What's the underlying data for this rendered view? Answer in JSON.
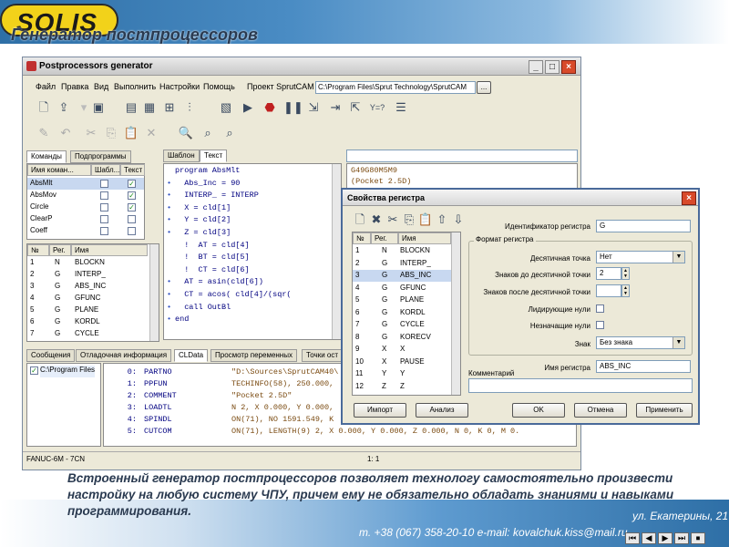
{
  "slide": {
    "logo": "SOLIS",
    "title": "Генератор постпроцессоров",
    "caption": "Встроенный генератор постпроцессоров позволяет технологу самостоятельно произвести настройку на любую систему ЧПУ, причем ему не обязательно обладать знаниями и навыками программирования.",
    "footer_address": "ул. Екатерины, 21",
    "footer_contact": "т. +38 (067) 358-20-10  e-mail: kovalchuk.kiss@mail.ru"
  },
  "window": {
    "title": "Postprocessors generator",
    "menu": [
      "Файл",
      "Правка",
      "Вид",
      "Выполнить",
      "Настройки",
      "Помощь"
    ],
    "project_label": "Проект SprutCAM",
    "project_path": "C:\\Program Files\\Sprut Technology\\SprutCAM",
    "browse_label": "..."
  },
  "left_tabs": [
    "Команды",
    "Подпрограммы"
  ],
  "commands": {
    "headers": [
      "Имя коман...",
      "Шабл...",
      "Текст"
    ],
    "rows": [
      {
        "name": "AbsMlt",
        "template": false,
        "text": true
      },
      {
        "name": "AbsMov",
        "template": false,
        "text": true
      },
      {
        "name": "Circle",
        "template": false,
        "text": true
      },
      {
        "name": "ClearP",
        "template": false,
        "text": false
      },
      {
        "name": "Coeff",
        "template": false,
        "text": false
      }
    ]
  },
  "registers": {
    "headers": [
      "№",
      "Рег.",
      "Имя"
    ],
    "rows": [
      [
        "1",
        "N",
        "BLOCKN"
      ],
      [
        "2",
        "G",
        "INTERP_"
      ],
      [
        "3",
        "G",
        "ABS_INC"
      ],
      [
        "4",
        "G",
        "GFUNC"
      ],
      [
        "5",
        "G",
        "PLANE"
      ],
      [
        "6",
        "G",
        "KORDL"
      ],
      [
        "7",
        "G",
        "CYCLE"
      ]
    ]
  },
  "editor_tabs": [
    "Шаблон",
    "Текст"
  ],
  "code_lines": [
    {
      "b": "",
      "t": "program AbsMlt"
    },
    {
      "b": "•",
      "t": "  Abs_Inc = 90"
    },
    {
      "b": "•",
      "t": "  INTERP_ = INTERP"
    },
    {
      "b": "•",
      "t": "  X = cld[1]"
    },
    {
      "b": "•",
      "t": "  Y = cld[2]"
    },
    {
      "b": "•",
      "t": "  Z = cld[3]"
    },
    {
      "b": "",
      "t": "  !  AT = cld[4]"
    },
    {
      "b": "",
      "t": "  !  BT = cld[5]"
    },
    {
      "b": "",
      "t": "  !  CT = cld[6]"
    },
    {
      "b": "•",
      "t": "  AT = asin(cld[6])"
    },
    {
      "b": "•",
      "t": "  CT = acos( cld[4]/(sqr("
    },
    {
      "b": "•",
      "t": "  call OutBl"
    },
    {
      "b": "•",
      "t": "end"
    }
  ],
  "output_preview": [
    "G49G80M5M9",
    "(Pocket 2.5D)"
  ],
  "bottom_tabs": [
    "Сообщения",
    "Отладочная информация",
    "CLData",
    "Просмотр переменных",
    "Точки ост"
  ],
  "tree_item": "C:\\Program Files",
  "cldata": [
    {
      "n": "0:",
      "cmd": "PARTNO",
      "args": "\"D:\\Sources\\SprutCAM40\\"
    },
    {
      "n": "1:",
      "cmd": "PPFUN",
      "args": "TECHINFO(58), 250.000,"
    },
    {
      "n": "2:",
      "cmd": "COMMENT",
      "args": "\"Pocket 2.5D\""
    },
    {
      "n": "3:",
      "cmd": "LOADTL",
      "args": "N 2, X 0.000, Y 0.000,"
    },
    {
      "n": "4:",
      "cmd": "SPINDL",
      "args": "ON(71), NO 1591.549, K"
    },
    {
      "n": "5:",
      "cmd": "CUTCOM",
      "args": "ON(71), LENGTH(9) 2, X 0.000, Y 0.000, Z 0.000, N 0, K 0, M 0."
    }
  ],
  "statusbar": {
    "cnc": "FANUC-6M - 7CN",
    "pos": "1:  1"
  },
  "dialog": {
    "title": "Свойства регистра",
    "table_headers": [
      "№",
      "Рег.",
      "Имя"
    ],
    "table_rows": [
      [
        "1",
        "N",
        "BLOCKN"
      ],
      [
        "2",
        "G",
        "INTERP_"
      ],
      [
        "3",
        "G",
        "ABS_INC"
      ],
      [
        "4",
        "G",
        "GFUNC"
      ],
      [
        "5",
        "G",
        "PLANE"
      ],
      [
        "6",
        "G",
        "KORDL"
      ],
      [
        "7",
        "G",
        "CYCLE"
      ],
      [
        "8",
        "G",
        "KORECV"
      ],
      [
        "9",
        "X",
        "X"
      ],
      [
        "10",
        "X",
        "PAUSE"
      ],
      [
        "11",
        "Y",
        "Y"
      ],
      [
        "12",
        "Z",
        "Z"
      ]
    ],
    "selected_index": 2,
    "id_label": "Идентификатор регистра",
    "id_value": "G",
    "format_group": "Формат регистра",
    "decimal_point_label": "Десятичная точка",
    "decimal_point_value": "Нет",
    "digits_before_label": "Знаков до десятичной точки",
    "digits_before_value": "2",
    "digits_after_label": "Знаков после десятичной точки",
    "digits_after_value": "",
    "leading_zeros_label": "Лидирующие нули",
    "trailing_zeros_label": "Незначащие нули",
    "sign_label": "Знак",
    "sign_value": "Без знака",
    "reg_name_label": "Имя регистра",
    "reg_name_value": "ABS_INC",
    "comment_label": "Комментарий",
    "buttons": {
      "import": "Импорт",
      "analysis": "Анализ",
      "ok": "OK",
      "cancel": "Отмена",
      "apply": "Применить"
    }
  }
}
